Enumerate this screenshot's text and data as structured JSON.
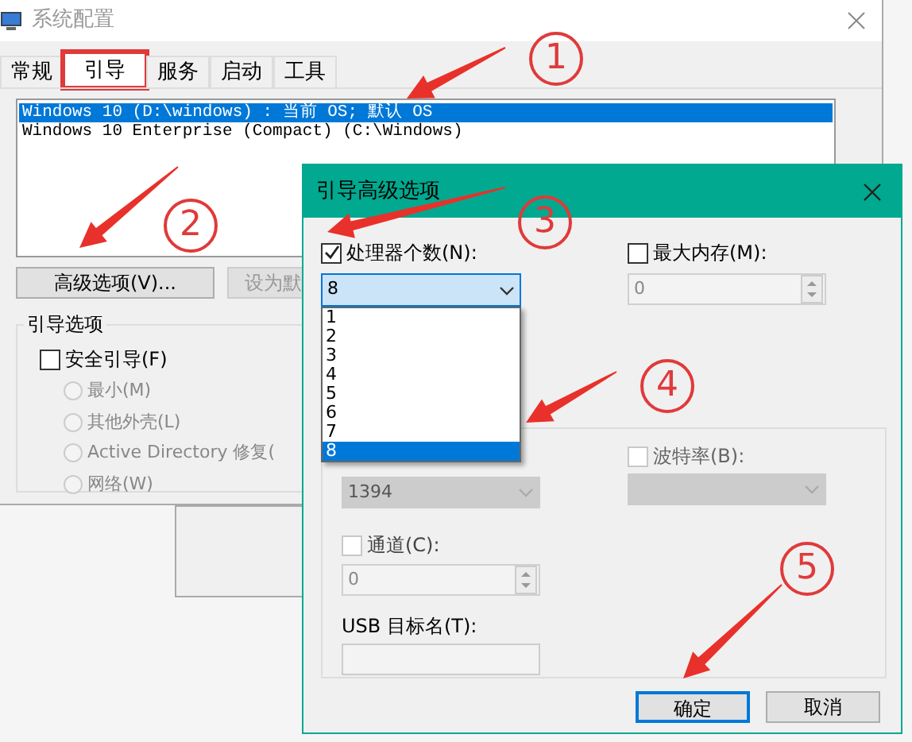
{
  "window": {
    "title": "系统配置"
  },
  "tabs": [
    {
      "label": "常规",
      "selected": false,
      "highlighted": false
    },
    {
      "label": "引导",
      "selected": true,
      "highlighted": true
    },
    {
      "label": "服务",
      "selected": false,
      "highlighted": false
    },
    {
      "label": "启动",
      "selected": false,
      "highlighted": false
    },
    {
      "label": "工具",
      "selected": false,
      "highlighted": false
    }
  ],
  "boot_list": [
    {
      "text": "Windows 10 (D:\\windows) : 当前 OS; 默认 OS",
      "selected": true
    },
    {
      "text": "Windows 10 Enterprise (Compact) (C:\\Windows)",
      "selected": false
    }
  ],
  "buttons": [
    {
      "label": "高级选项(V)...",
      "disabled": false
    },
    {
      "label": "设为默",
      "disabled": true
    }
  ],
  "boot_options": {
    "title": "引导选项",
    "safe_boot": {
      "label": "安全引导(F)",
      "checked": false
    },
    "modes": [
      {
        "label": "最小(M)",
        "selected": false,
        "disabled": true
      },
      {
        "label": "其他外壳(L)",
        "selected": false,
        "disabled": true
      },
      {
        "label": "Active Directory 修复(",
        "selected": false,
        "disabled": true
      },
      {
        "label": "网络(W)",
        "selected": false,
        "disabled": true
      }
    ]
  },
  "dialog": {
    "title": "引导高级选项",
    "processors": {
      "label": "处理器个数(N):",
      "checked": true,
      "value": "8",
      "expanded": true,
      "options": [
        {
          "label": "1",
          "selected": false
        },
        {
          "label": "2",
          "selected": false
        },
        {
          "label": "3",
          "selected": false
        },
        {
          "label": "4",
          "selected": false
        },
        {
          "label": "5",
          "selected": false
        },
        {
          "label": "6",
          "selected": false
        },
        {
          "label": "7",
          "selected": false
        },
        {
          "label": "8",
          "selected": true
        }
      ]
    },
    "max_memory": {
      "label": "最大内存(M):",
      "checked": false,
      "value": "0"
    },
    "debug_port": {
      "value": "1394"
    },
    "baud_rate": {
      "label": "波特率(B):",
      "checked": false
    },
    "channel": {
      "label": "通道(C):",
      "checked": false,
      "value": "0"
    },
    "usb_target": {
      "label": "USB 目标名(T):"
    },
    "buttons": [
      {
        "label": "确定",
        "focused": true
      },
      {
        "label": "取消",
        "focused": false
      }
    ]
  },
  "callouts": [
    "1",
    "2",
    "3",
    "4",
    "5"
  ]
}
